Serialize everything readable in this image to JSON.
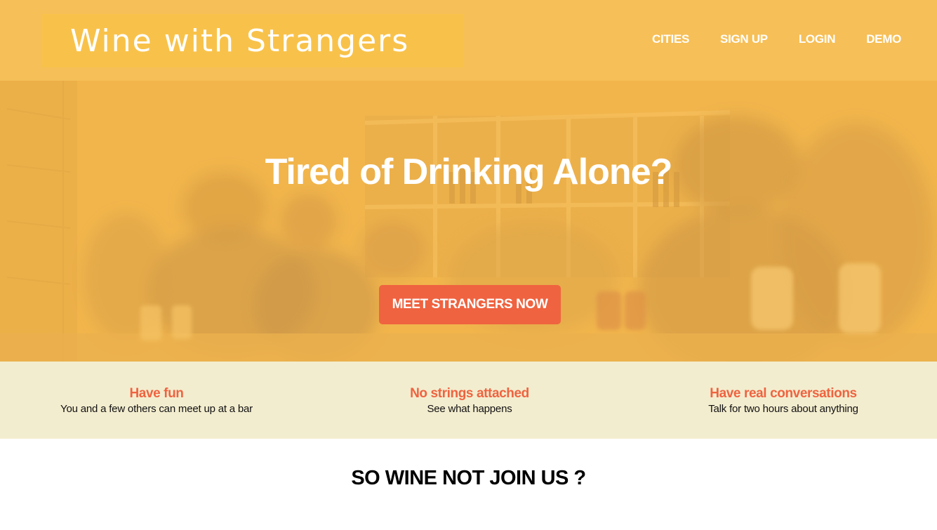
{
  "header": {
    "logo": "Wine with Strangers",
    "nav": [
      "CITIES",
      "SIGN UP",
      "LOGIN",
      "DEMO"
    ]
  },
  "hero": {
    "title": "Tired of Drinking Alone?",
    "cta_label": "MEET STRANGERS NOW"
  },
  "features": [
    {
      "title": "Have fun",
      "description": "You and a few others can meet up at a bar"
    },
    {
      "title": "No strings attached",
      "description": "See what happens"
    },
    {
      "title": "Have real conversations",
      "description": "Talk for two hours about anything"
    }
  ],
  "join": {
    "title": "SO WINE NOT JOIN US ?"
  },
  "colors": {
    "header_bg": "#f6bf57",
    "accent": "#ef6340",
    "features_bg": "#f3edcf"
  }
}
